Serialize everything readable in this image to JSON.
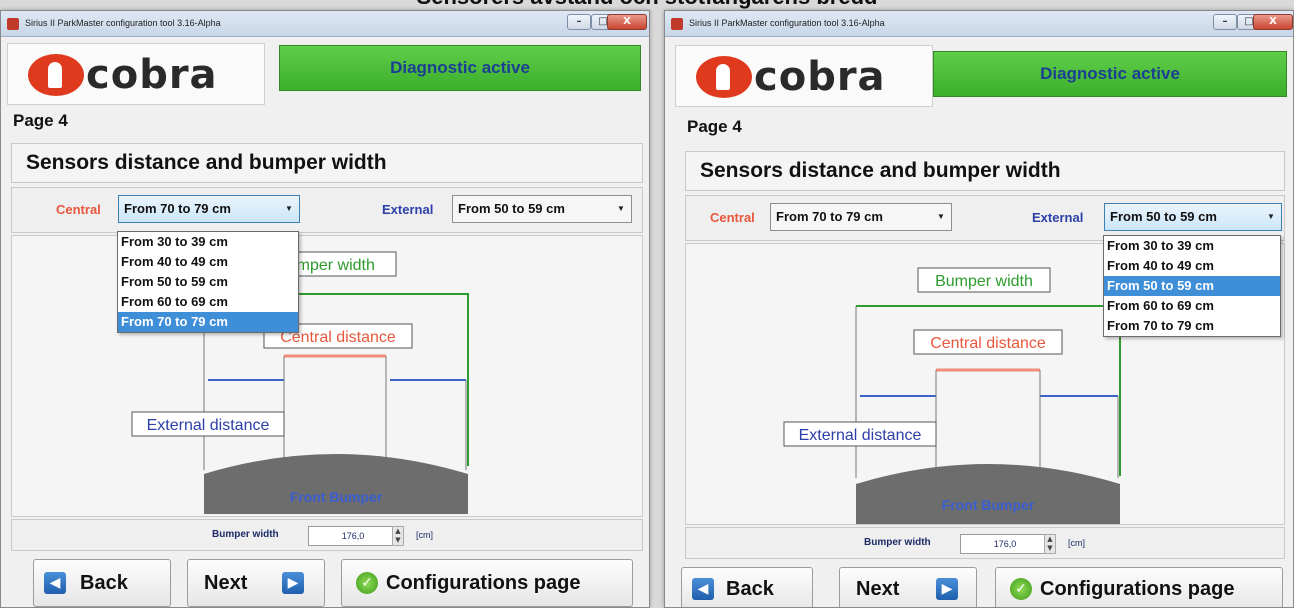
{
  "heading": "Sensorers avstand och stötfångarens bredd",
  "window": {
    "title": "Sirius II ParkMaster configuration tool  3.16-Alpha",
    "minimize": "–",
    "maximize": "□",
    "close": "X"
  },
  "logo_text": "cobra",
  "status": "Diagnostic active",
  "page_label": "Page 4",
  "section_title": "Sensors distance and bumper width",
  "central_label": "Central",
  "external_label": "External",
  "options": [
    "From 30 to 39 cm",
    "From 40 to 49 cm",
    "From 50 to 59 cm",
    "From 60 to 69 cm",
    "From 70 to 79 cm"
  ],
  "left": {
    "central_value": "From 70 to 79 cm",
    "external_value": "From 50 to 59 cm",
    "open": "central",
    "highlighted_index": 4
  },
  "right": {
    "central_value": "From 70 to 79 cm",
    "external_value": "From 50 to 59 cm",
    "open": "external",
    "highlighted_index": 2
  },
  "diagram": {
    "bumper_width_label": "Bumper width",
    "central_distance_label": "Central distance",
    "external_distance_label": "External distance",
    "front_bumper_label": "Front Bumper"
  },
  "bumper_width": {
    "label": "Bumper width",
    "value": "176,0",
    "unit": "[cm]"
  },
  "buttons": {
    "back": "Back",
    "next": "Next",
    "config": "Configurations page"
  },
  "colors": {
    "status_green": "#3cae2c",
    "central": "#e8573c",
    "external": "#2c3fa8",
    "bumper_line": "#2e9b2e",
    "highlight": "#3f8fd8"
  }
}
